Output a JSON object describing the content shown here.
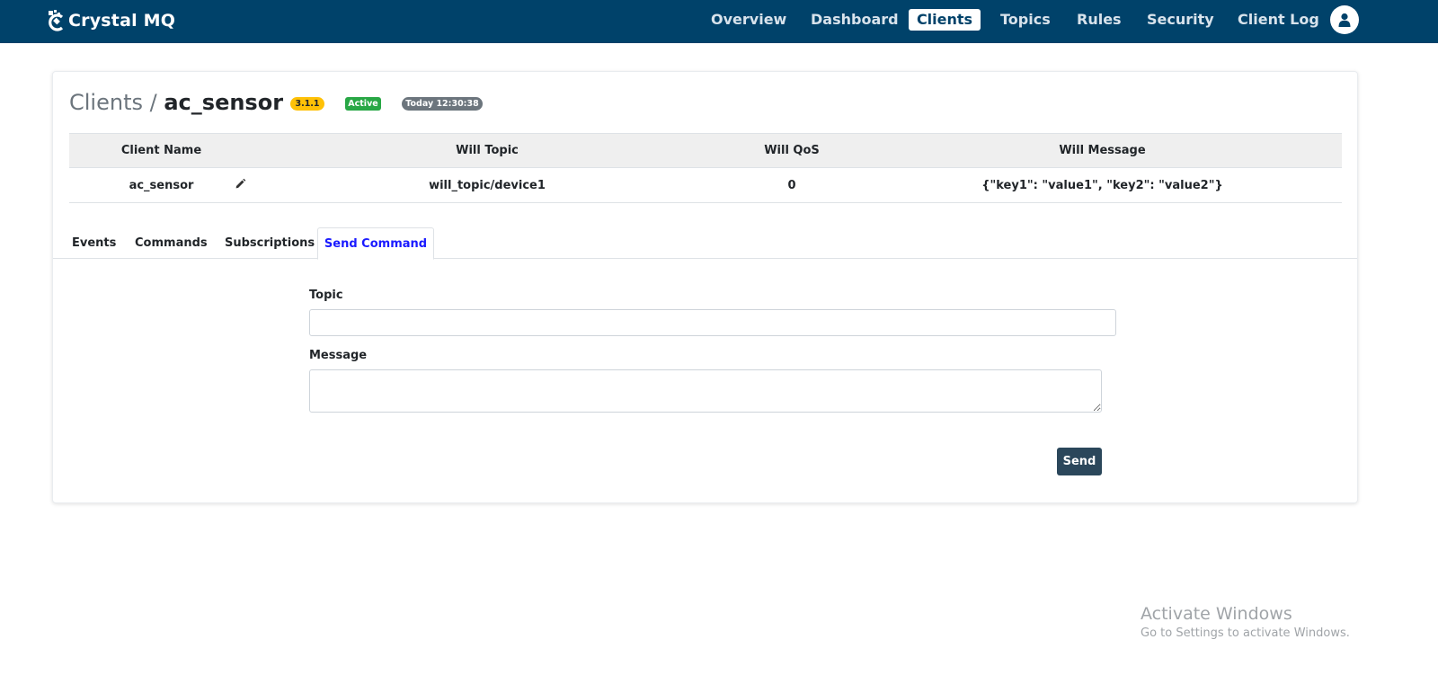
{
  "navbar": {
    "brand": "Crystal MQ",
    "brand_icon": "crystal-logo-icon",
    "items": [
      {
        "label": "Overview"
      },
      {
        "label": "Dashboard"
      },
      {
        "label": "Clients",
        "active": true
      },
      {
        "label": "Topics"
      },
      {
        "label": "Rules"
      },
      {
        "label": "Security"
      },
      {
        "label": "Client Log"
      }
    ],
    "avatar_icon": "user-icon",
    "colors": {
      "background": "#00426a",
      "active_bg": "#ffffff"
    }
  },
  "header": {
    "crumb_root": "Clients",
    "crumb_separator": "/",
    "client_id": "ac_sensor",
    "version_badge": "3.1.1",
    "status_badge": "Active",
    "time_badge": "Today 12:30:38"
  },
  "client_table": {
    "columns": [
      "Client Name",
      "Will Topic",
      "Will QoS",
      "Will Message"
    ],
    "row": {
      "client_name": "ac_sensor",
      "will_topic": "will_topic/device1",
      "will_qos": "0",
      "will_message": "{\"key1\": \"value1\", \"key2\": \"value2\"}"
    },
    "edit_icon": "pencil-icon"
  },
  "tabs": [
    {
      "label": "Events"
    },
    {
      "label": "Commands"
    },
    {
      "label": "Subscriptions"
    },
    {
      "label": "Send Command",
      "active": true
    }
  ],
  "send_form": {
    "topic_label": "Topic",
    "topic_value": "",
    "message_label": "Message",
    "message_value": "",
    "send_label": "Send"
  },
  "watermark": {
    "title": "Activate Windows",
    "subtitle": "Go to Settings to activate Windows."
  }
}
